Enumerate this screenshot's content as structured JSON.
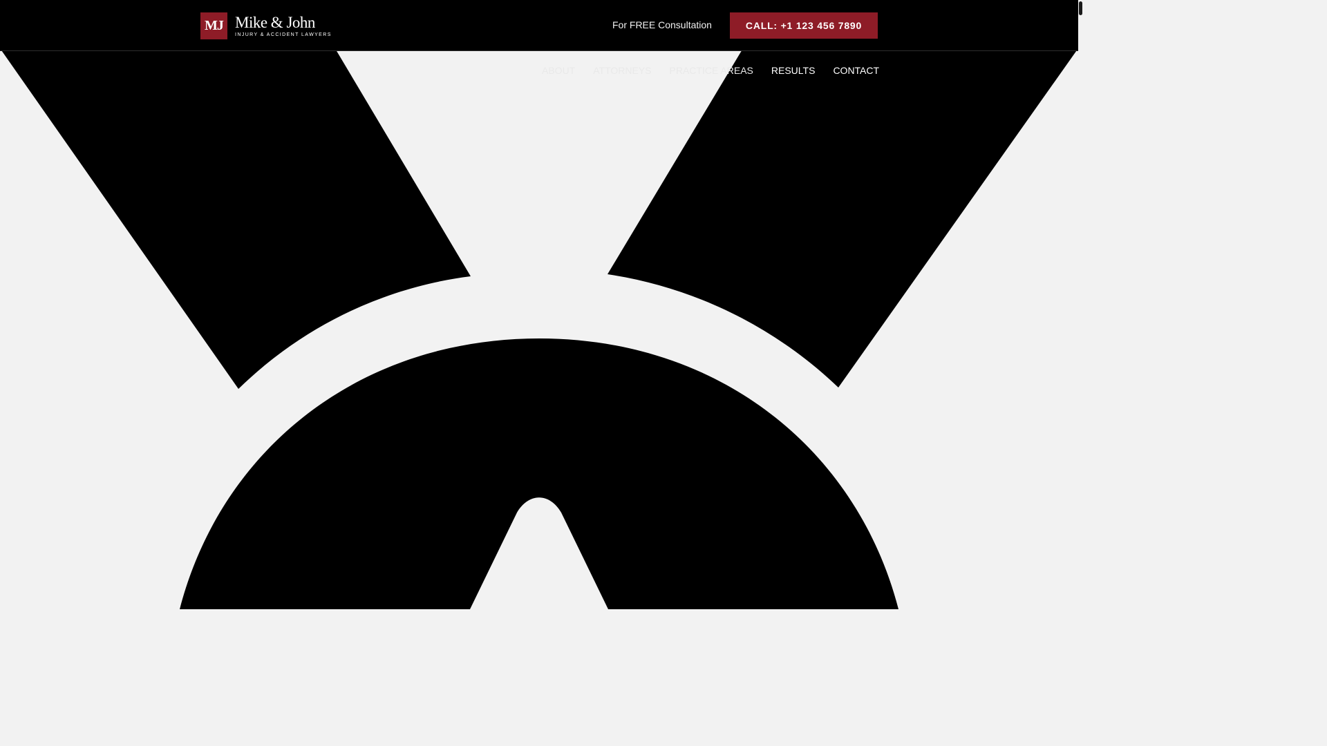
{
  "colors": {
    "brand": "#8e1c27",
    "background": "#f2f2f2",
    "hero_shape": "#000000"
  },
  "logo": {
    "mark": "MJ",
    "name": "Mike & John",
    "tagline": "INJURY & ACCIDENT LAWYERS"
  },
  "topbar": {
    "consultation_text": "For FREE Consultation",
    "call_label": "CALL: +1 123 456 7890"
  },
  "nav": {
    "items": [
      {
        "label": "ABOUT"
      },
      {
        "label": "ATTORNEYS"
      },
      {
        "label": "PRACTICE AREAS"
      },
      {
        "label": "RESULTS"
      },
      {
        "label": "CONTACT"
      }
    ]
  },
  "hero": {
    "icon": "large-black-emblem-icon"
  }
}
